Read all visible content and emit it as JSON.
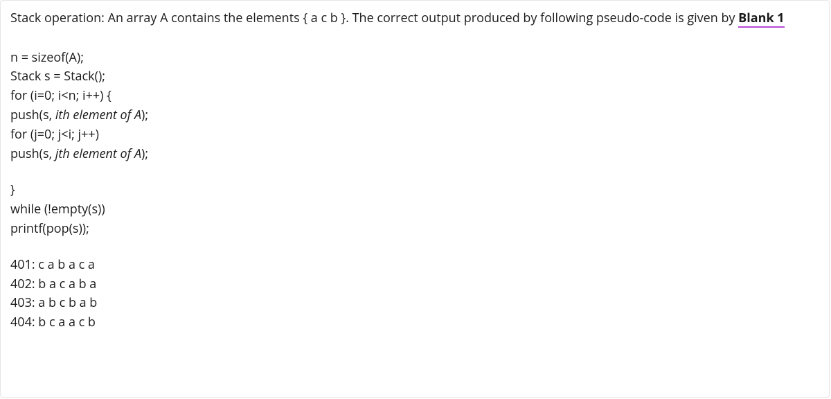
{
  "question": {
    "prefix": "Stack operation: An array A contains the elements { a c b }. The correct output produced by following pseudo-code is given by ",
    "blank_label": "Blank 1"
  },
  "code": {
    "l1": "n = sizeof(A);",
    "l2": "Stack s = Stack();",
    "l3": "for (i=0; i<n; i++) {",
    "l4a": "push(s, ",
    "l4b": "ith element of A",
    "l4c": ");",
    "l5": "for (j=0; j<i; j++)",
    "l6a": "push(s, ",
    "l6b": "jth element of A",
    "l6c": ");",
    "l7": "}",
    "l8": "while (!empty(s))",
    "l9": "printf(pop(s));"
  },
  "options": {
    "o1": "401: c a b a c a",
    "o2": "402: b a c a b a",
    "o3": "403: a b c b a b",
    "o4": "404: b c a a c b"
  }
}
